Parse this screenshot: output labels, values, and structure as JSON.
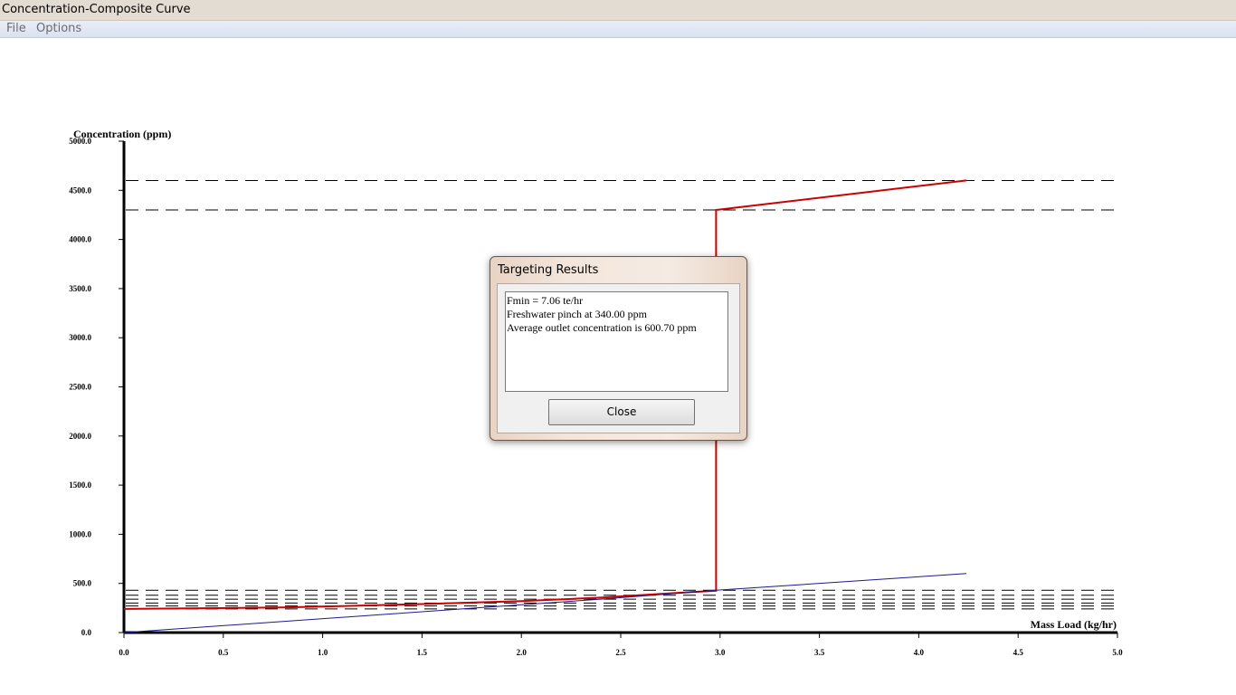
{
  "window": {
    "title": "Concentration-Composite Curve"
  },
  "menu": {
    "items": [
      "File",
      "Options"
    ]
  },
  "chart_data": {
    "type": "line",
    "ylabel": "Concentration (ppm)",
    "xlabel": "Mass Load (kg/hr)",
    "xlim": [
      0,
      5
    ],
    "ylim": [
      0,
      5000
    ],
    "x_ticks": [
      "0.0",
      "0.5",
      "1.0",
      "1.5",
      "2.0",
      "2.5",
      "3.0",
      "3.5",
      "4.0",
      "4.5",
      "5.0"
    ],
    "y_ticks": [
      "0.0",
      "500.0",
      "1000.0",
      "1500.0",
      "2000.0",
      "2500.0",
      "3000.0",
      "3500.0",
      "4000.0",
      "4500.0",
      "5000.0"
    ],
    "dashed_levels": [
      4600,
      4300,
      430,
      380,
      340,
      300,
      270,
      240
    ],
    "series": [
      {
        "color": "#cc0000",
        "points": [
          [
            0.0,
            240
          ],
          [
            0.8,
            255
          ],
          [
            1.5,
            290
          ],
          [
            2.0,
            320
          ],
          [
            2.4,
            355
          ],
          [
            2.75,
            400
          ],
          [
            2.98,
            425
          ],
          [
            2.98,
            4300
          ],
          [
            4.24,
            4600
          ]
        ]
      },
      {
        "color": "#1a1a8c",
        "points": [
          [
            0.0,
            0
          ],
          [
            1.7,
            240
          ],
          [
            2.4,
            340
          ],
          [
            2.98,
            430
          ],
          [
            4.24,
            600
          ]
        ]
      }
    ]
  },
  "dialog": {
    "title": "Targeting Results",
    "lines": [
      "Fmin = 7.06 te/hr",
      "Freshwater pinch at 340.00 ppm",
      "Average outlet concentration is 600.70 ppm"
    ],
    "close_label": "Close"
  }
}
